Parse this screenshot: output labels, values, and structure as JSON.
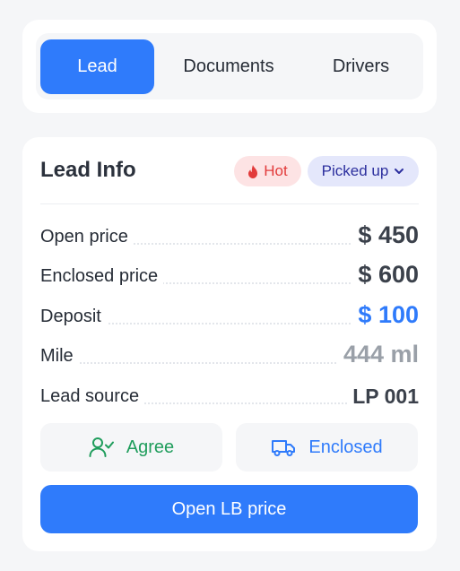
{
  "tabs": [
    {
      "label": "Lead",
      "active": true
    },
    {
      "label": "Documents",
      "active": false
    },
    {
      "label": "Drivers",
      "active": false
    }
  ],
  "lead_info": {
    "title": "Lead Info",
    "hot_badge": {
      "label": "Hot",
      "icon": "fire-icon",
      "color": "#e23b3b"
    },
    "status": {
      "label": "Picked up",
      "icon": "chevron-down-icon"
    },
    "rows": [
      {
        "label": "Open price",
        "value": "$ 450"
      },
      {
        "label": "Enclosed price",
        "value": "$ 600"
      },
      {
        "label": "Deposit",
        "value": "$ 100"
      },
      {
        "label": "Mile",
        "value": "444 ml"
      },
      {
        "label": "Lead source",
        "value": "LP 001"
      }
    ],
    "agree_button": {
      "label": "Agree",
      "icon": "user-check-icon",
      "color": "#1f9d5c"
    },
    "enclosed_button": {
      "label": "Enclosed",
      "icon": "truck-icon",
      "color": "#2f7bfb"
    },
    "primary_button": {
      "label": "Open LB price"
    }
  },
  "colors": {
    "accent": "#2f7bfb",
    "background": "#f5f6f8"
  }
}
